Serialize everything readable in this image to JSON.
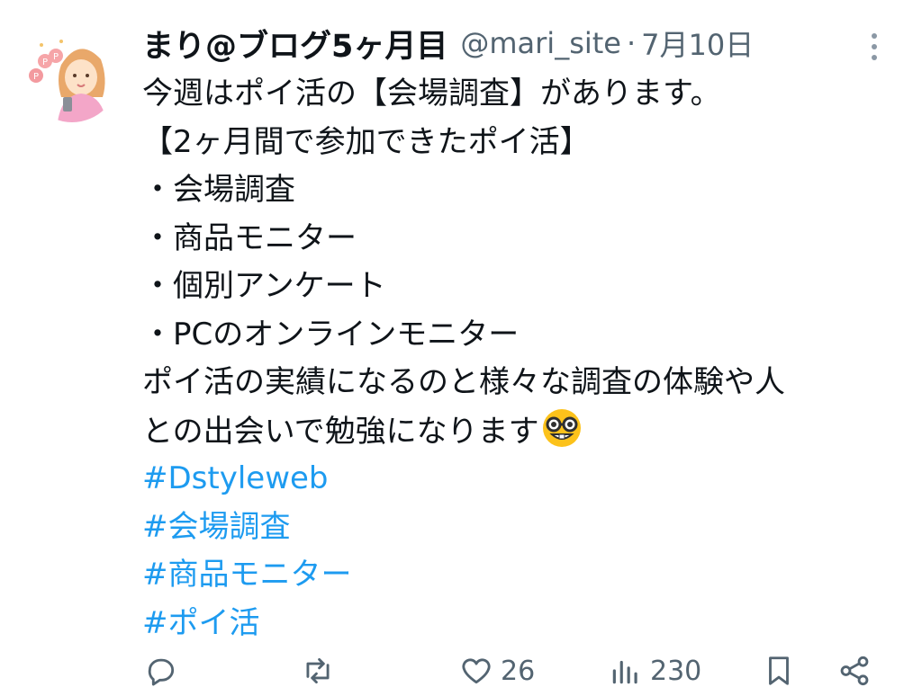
{
  "tweet": {
    "author_name": "まり@ブログ5ヶ月目",
    "handle": "@mari_site",
    "separator": "·",
    "date": "7月10日",
    "lines": [
      "今週はポイ活の【会場調査】があります。",
      "【2ヶ月間で参加できたポイ活】",
      "・会場調査",
      "・商品モニター",
      "・個別アンケート",
      "・PCのオンラインモニター",
      "ポイ活の実績になるのと様々な調査の体験や人",
      "との出会いで勉強になります"
    ],
    "emoji": "nerd-face-emoji",
    "hashtags": [
      "#Dstyleweb",
      "#会場調査",
      "#商品モニター",
      "#ポイ活"
    ]
  },
  "actions": {
    "reply": {
      "icon": "reply-icon",
      "count": ""
    },
    "retweet": {
      "icon": "retweet-icon",
      "count": ""
    },
    "like": {
      "icon": "heart-icon",
      "count": "26"
    },
    "views": {
      "icon": "views-icon",
      "count": "230"
    },
    "bookmark": {
      "icon": "bookmark-icon",
      "count": ""
    },
    "share": {
      "icon": "share-icon",
      "count": ""
    }
  },
  "colors": {
    "text": "#0f1419",
    "secondary": "#536471",
    "hashtag": "#1d9bf0",
    "icon": "#536471"
  }
}
